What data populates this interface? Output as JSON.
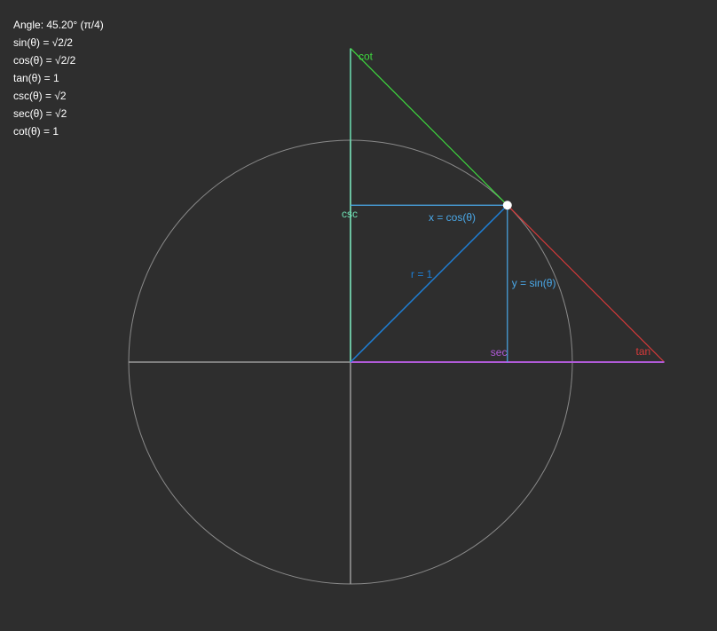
{
  "readout": {
    "angle": "Angle: 45.20° (π/4)",
    "sin": "sin(θ) = √2/2",
    "cos": "cos(θ) = √2/2",
    "tan": "tan(θ) = 1",
    "csc": "csc(θ) = √2",
    "sec": "sec(θ) = √2",
    "cot": "cot(θ) = 1"
  },
  "diagram": {
    "angle_deg": 45.2,
    "labels": {
      "cot": "cot",
      "csc": "csc",
      "cos_segment": "x = cos(θ)",
      "radius": "r = 1",
      "sin_segment": "y = sin(θ)",
      "sec": "sec",
      "tan": "tan"
    },
    "colors": {
      "background": "#2e2e2e",
      "circle": "#8a8a8a",
      "axes": "#9a9a9a",
      "radius": "#1e7fd6",
      "sin_cos": "#4aa8e8",
      "csc": "#6fe0b4",
      "cot": "#3ed83e",
      "tan": "#d63a3a",
      "sec": "#b05ad8",
      "point": "#ffffff"
    }
  }
}
